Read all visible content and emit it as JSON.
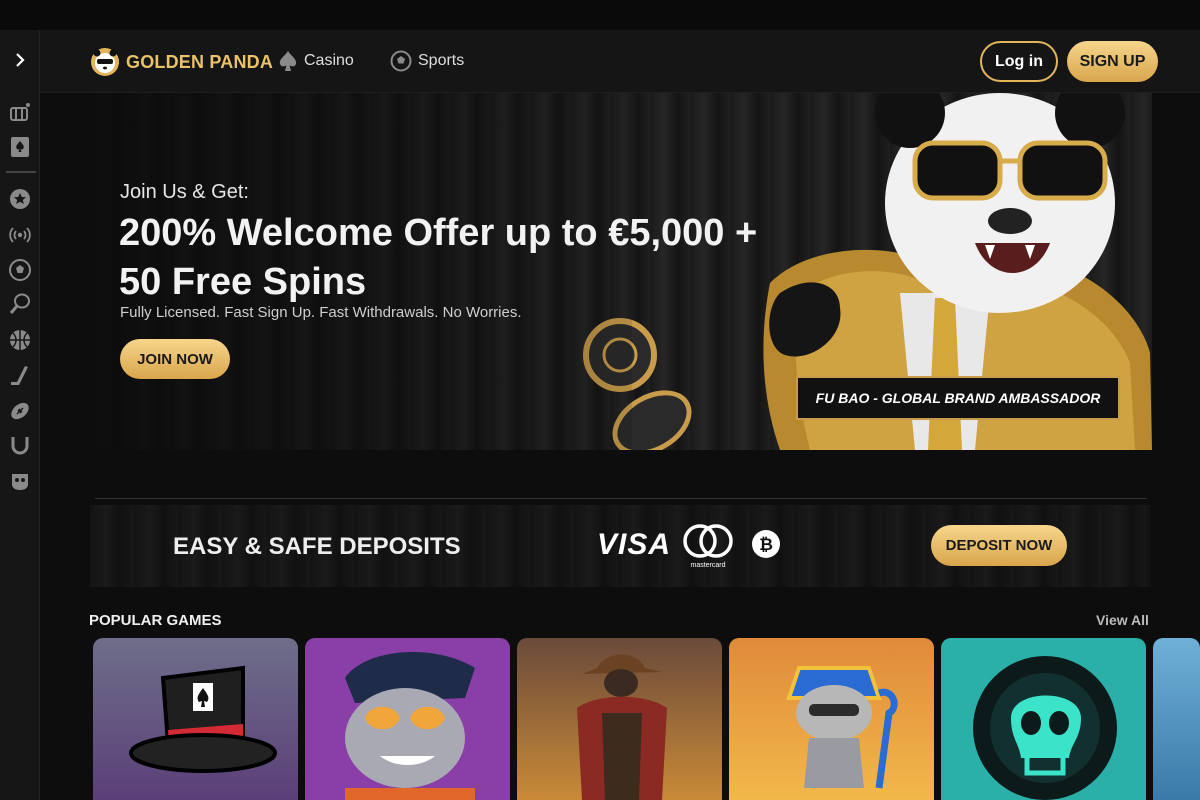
{
  "header": {
    "brand": "GOLDEN PANDA",
    "nav": [
      {
        "label": "Casino",
        "icon": "spade-icon"
      },
      {
        "label": "Sports",
        "icon": "soccer-ball-icon"
      }
    ],
    "login_label": "Log in",
    "signup_label": "SIGN UP"
  },
  "sidebar": {
    "icons": [
      "casino-chest-icon",
      "card-icon",
      "star-icon",
      "live-icon",
      "soccer-icon",
      "tennis-icon",
      "basketball-icon",
      "hockey-icon",
      "football-icon",
      "horse-racing-icon",
      "gamepad-icon"
    ]
  },
  "hero": {
    "kicker": "Join Us & Get:",
    "title": "200% Welcome Offer up to €5,000 + 50 Free Spins",
    "subtitle": "Fully Licensed. Fast Sign Up. Fast Withdrawals. No Worries.",
    "cta": "JOIN NOW",
    "ambassador": "FU BAO - GLOBAL BRAND AMBASSADOR"
  },
  "deposit": {
    "title": "EASY & SAFE DEPOSITS",
    "visa": "VISA",
    "mastercard": "mastercard",
    "cta": "DEPOSIT NOW"
  },
  "games": {
    "section_title": "POPULAR GAMES",
    "view_all": "View All"
  },
  "colors": {
    "gold": "#e3b55b",
    "gold_light": "#f6d68c",
    "background": "#0d0d0d"
  }
}
